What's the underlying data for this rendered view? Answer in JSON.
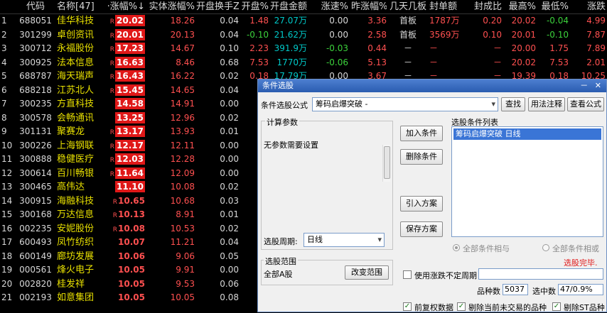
{
  "headers": {
    "idx": "",
    "code": "代码",
    "name": "名称[47]",
    "pct": "·涨幅%↓",
    "body": "实体涨幅%",
    "turn": "开盘换手Z",
    "open": "开盘%",
    "amt": "开盘金额",
    "spd": "涨速%",
    "yday": "昨涨幅%",
    "days": "几天几板",
    "seal": "封单额",
    "ratio": "封成比",
    "high": "最高%",
    "low": "最低%",
    "chg": "涨跌"
  },
  "rows": [
    {
      "idx": "1",
      "code": "688051",
      "name": "佳华科技",
      "pct": "20.02",
      "boxed": true,
      "r": true,
      "body": "18.26",
      "turn": "0.04",
      "open": "1.48",
      "open_c": "red",
      "amt": "27.07万",
      "spd": "0.00",
      "spd_c": "white",
      "yday": "3.36",
      "yday_c": "red",
      "days": "首板",
      "seal": "1787万",
      "ratio": "0.20",
      "high": "20.02",
      "low": "-0.04",
      "low_c": "green",
      "chg": "4.99"
    },
    {
      "idx": "2",
      "code": "301299",
      "name": "卓创资讯",
      "pct": "20.01",
      "boxed": true,
      "r": true,
      "body": "20.13",
      "turn": "0.04",
      "open": "-0.10",
      "open_c": "green",
      "amt": "21.62万",
      "spd": "0.00",
      "spd_c": "white",
      "yday": "2.58",
      "yday_c": "red",
      "days": "首板",
      "seal": "3569万",
      "ratio": "0.10",
      "high": "20.01",
      "low": "-0.10",
      "low_c": "green",
      "chg": "7.87"
    },
    {
      "idx": "3",
      "code": "300712",
      "name": "永福股份",
      "pct": "17.23",
      "boxed": true,
      "r": true,
      "body": "14.67",
      "turn": "0.10",
      "open": "2.23",
      "open_c": "red",
      "amt": "391.9万",
      "spd": "-0.03",
      "spd_c": "green",
      "yday": "0.44",
      "yday_c": "red",
      "days": "－",
      "seal": "－",
      "ratio": "－",
      "high": "20.00",
      "low": "1.75",
      "low_c": "red",
      "chg": "7.89"
    },
    {
      "idx": "4",
      "code": "300925",
      "name": "法本信息",
      "pct": "16.63",
      "boxed": true,
      "r": true,
      "body": "8.46",
      "turn": "0.68",
      "open": "7.53",
      "open_c": "red",
      "amt": "1770万",
      "spd": "-0.06",
      "spd_c": "green",
      "yday": "5.13",
      "yday_c": "red",
      "days": "－",
      "seal": "－",
      "ratio": "－",
      "high": "20.02",
      "low": "7.53",
      "low_c": "red",
      "chg": "2.01"
    },
    {
      "idx": "5",
      "code": "688787",
      "name": "海天瑞声",
      "pct": "16.43",
      "boxed": true,
      "r": true,
      "body": "16.22",
      "turn": "0.02",
      "open": "0.18",
      "open_c": "red",
      "amt": "17.79万",
      "spd": "0.00",
      "spd_c": "white",
      "yday": "3.67",
      "yday_c": "red",
      "days": "－",
      "seal": "－",
      "ratio": "－",
      "high": "19.39",
      "low": "0.18",
      "low_c": "red",
      "chg": "10.25"
    },
    {
      "idx": "6",
      "code": "688218",
      "name": "江苏北人",
      "pct": "15.45",
      "boxed": true,
      "r": true,
      "body": "14.65",
      "turn": "0.04",
      "open": "0",
      "open_c": "white",
      "amt": "",
      "spd": "",
      "spd_c": "white",
      "yday": "",
      "yday_c": "red",
      "days": "",
      "seal": "",
      "ratio": "",
      "high": "",
      "low": "",
      "low_c": "red",
      "chg": ""
    },
    {
      "idx": "7",
      "code": "300235",
      "name": "方直科技",
      "pct": "14.58",
      "boxed": true,
      "r": false,
      "body": "14.91",
      "turn": "0.00",
      "open": "-0.",
      "open_c": "green",
      "amt": "",
      "spd": "",
      "spd_c": "white",
      "yday": "",
      "yday_c": "red",
      "days": "",
      "seal": "",
      "ratio": "",
      "high": "",
      "low": "",
      "low_c": "red",
      "chg": ""
    },
    {
      "idx": "8",
      "code": "300578",
      "name": "会畅通讯",
      "pct": "13.25",
      "boxed": true,
      "r": false,
      "body": "12.96",
      "turn": "0.02",
      "open": "0.",
      "open_c": "red",
      "amt": "",
      "spd": "",
      "spd_c": "white",
      "yday": "",
      "yday_c": "red",
      "days": "",
      "seal": "",
      "ratio": "",
      "high": "",
      "low": "",
      "low_c": "red",
      "chg": ""
    },
    {
      "idx": "9",
      "code": "301131",
      "name": "聚赛龙",
      "pct": "13.17",
      "boxed": true,
      "r": true,
      "body": "13.93",
      "turn": "0.01",
      "open": "-0.",
      "open_c": "green",
      "amt": "",
      "spd": "",
      "spd_c": "white",
      "yday": "",
      "yday_c": "red",
      "days": "",
      "seal": "",
      "ratio": "",
      "high": "",
      "low": "",
      "low_c": "red",
      "chg": ""
    },
    {
      "idx": "10",
      "code": "300226",
      "name": "上海钢联",
      "pct": "12.17",
      "boxed": true,
      "r": true,
      "body": "12.11",
      "turn": "0.00",
      "open": "0.",
      "open_c": "red",
      "amt": "",
      "spd": "",
      "spd_c": "white",
      "yday": "",
      "yday_c": "red",
      "days": "",
      "seal": "",
      "ratio": "",
      "high": "",
      "low": "",
      "low_c": "red",
      "chg": ""
    },
    {
      "idx": "11",
      "code": "300888",
      "name": "稳健医疗",
      "pct": "12.03",
      "boxed": true,
      "r": true,
      "body": "12.28",
      "turn": "0.00",
      "open": "-0.",
      "open_c": "green",
      "amt": "",
      "spd": "",
      "spd_c": "white",
      "yday": "",
      "yday_c": "red",
      "days": "",
      "seal": "",
      "ratio": "",
      "high": "",
      "low": "",
      "low_c": "red",
      "chg": ""
    },
    {
      "idx": "12",
      "code": "300614",
      "name": "百川畅银",
      "pct": "11.64",
      "boxed": true,
      "r": true,
      "body": "12.09",
      "turn": "0.00",
      "open": "-0.",
      "open_c": "green",
      "amt": "",
      "spd": "",
      "spd_c": "white",
      "yday": "",
      "yday_c": "red",
      "days": "",
      "seal": "",
      "ratio": "",
      "high": "",
      "low": "",
      "low_c": "red",
      "chg": ""
    },
    {
      "idx": "13",
      "code": "300465",
      "name": "高伟达",
      "pct": "11.10",
      "boxed": true,
      "r": false,
      "body": "10.08",
      "turn": "0.02",
      "open": "0.",
      "open_c": "red",
      "amt": "",
      "spd": "",
      "spd_c": "white",
      "yday": "",
      "yday_c": "red",
      "days": "",
      "seal": "",
      "ratio": "",
      "high": "",
      "low": "",
      "low_c": "red",
      "chg": ""
    },
    {
      "idx": "14",
      "code": "300915",
      "name": "海融科技",
      "pct": "10.65",
      "boxed": false,
      "r": true,
      "body": "10.68",
      "turn": "0.03",
      "open": "-0.",
      "open_c": "green",
      "amt": "",
      "spd": "",
      "spd_c": "white",
      "yday": "",
      "yday_c": "red",
      "days": "",
      "seal": "",
      "ratio": "",
      "high": "",
      "low": "",
      "low_c": "red",
      "chg": ""
    },
    {
      "idx": "15",
      "code": "300168",
      "name": "万达信息",
      "pct": "10.13",
      "boxed": false,
      "r": true,
      "body": "8.91",
      "turn": "0.01",
      "open": "1.",
      "open_c": "red",
      "amt": "",
      "spd": "",
      "spd_c": "white",
      "yday": "",
      "yday_c": "red",
      "days": "",
      "seal": "",
      "ratio": "",
      "high": "",
      "low": "",
      "low_c": "red",
      "chg": ""
    },
    {
      "idx": "16",
      "code": "002235",
      "name": "安妮股份",
      "pct": "10.08",
      "boxed": false,
      "r": true,
      "body": "10.53",
      "turn": "0.02",
      "open": "-0.",
      "open_c": "green",
      "amt": "",
      "spd": "",
      "spd_c": "white",
      "yday": "",
      "yday_c": "red",
      "days": "",
      "seal": "",
      "ratio": "",
      "high": "",
      "low": "",
      "low_c": "red",
      "chg": ""
    },
    {
      "idx": "17",
      "code": "600493",
      "name": "凤竹纺织",
      "pct": "10.07",
      "boxed": false,
      "r": false,
      "body": "11.21",
      "turn": "0.04",
      "open": "-1.",
      "open_c": "green",
      "amt": "",
      "spd": "",
      "spd_c": "white",
      "yday": "",
      "yday_c": "red",
      "days": "",
      "seal": "",
      "ratio": "",
      "high": "",
      "low": "",
      "low_c": "red",
      "chg": ""
    },
    {
      "idx": "18",
      "code": "600149",
      "name": "廊坊发展",
      "pct": "10.06",
      "boxed": false,
      "r": false,
      "body": "9.06",
      "turn": "0.05",
      "open": "0.",
      "open_c": "red",
      "amt": "",
      "spd": "",
      "spd_c": "white",
      "yday": "",
      "yday_c": "red",
      "days": "",
      "seal": "",
      "ratio": "",
      "high": "",
      "low": "",
      "low_c": "red",
      "chg": ""
    },
    {
      "idx": "19",
      "code": "000561",
      "name": "烽火电子",
      "pct": "10.05",
      "boxed": false,
      "r": false,
      "body": "9.91",
      "turn": "0.00",
      "open": "0.",
      "open_c": "red",
      "amt": "",
      "spd": "",
      "spd_c": "white",
      "yday": "",
      "yday_c": "red",
      "days": "",
      "seal": "",
      "ratio": "",
      "high": "",
      "low": "",
      "low_c": "red",
      "chg": ""
    },
    {
      "idx": "20",
      "code": "002820",
      "name": "桂发祥",
      "pct": "10.05",
      "boxed": false,
      "r": false,
      "body": "9.53",
      "turn": "0.06",
      "open": "0.",
      "open_c": "red",
      "amt": "",
      "spd": "",
      "spd_c": "white",
      "yday": "",
      "yday_c": "red",
      "days": "",
      "seal": "",
      "ratio": "",
      "high": "",
      "low": "",
      "low_c": "red",
      "chg": ""
    },
    {
      "idx": "21",
      "code": "002193",
      "name": "如意集团",
      "pct": "10.05",
      "boxed": false,
      "r": false,
      "body": "10.05",
      "turn": "0.08",
      "open": "0.",
      "open_c": "red",
      "amt": "",
      "spd": "",
      "spd_c": "white",
      "yday": "",
      "yday_c": "red",
      "days": "",
      "seal": "",
      "ratio": "",
      "high": "",
      "low": "",
      "low_c": "red",
      "chg": ""
    }
  ],
  "dialog": {
    "title": "条件选股",
    "controls": "－ ✕",
    "formula_label": "条件选股公式",
    "formula_value": "筹码启爆突破 -",
    "btn_find": "查找",
    "btn_usage": "用法注释",
    "btn_formula": "查看公式",
    "calc_params_label": "计算参数",
    "no_params": "无参数需要设置",
    "btn_add": "加入条件",
    "btn_delete": "删除条件",
    "btn_import": "引入方案",
    "btn_save": "保存方案",
    "list_label": "选股条件列表",
    "list_items": [
      "筹码启爆突破  日线"
    ],
    "period_label": "选股周期:",
    "period_value": "日线",
    "radio_and": "全部条件相与",
    "radio_or": "全部条件相或",
    "status": "选股完毕.",
    "range_label": "选股范围",
    "range_value": "全部A股",
    "btn_range": "改变范围",
    "chk_variable_period": "使用涨跌不定周期",
    "count_label": "品种数",
    "count_value": "5037",
    "hit_label": "选中数",
    "hit_value": "47/0.9%",
    "chk_prev_adjust": "前复权数据",
    "chk_remove_untraded": "剔除当前未交易的品种",
    "chk_remove_st": "剔除ST品种"
  }
}
